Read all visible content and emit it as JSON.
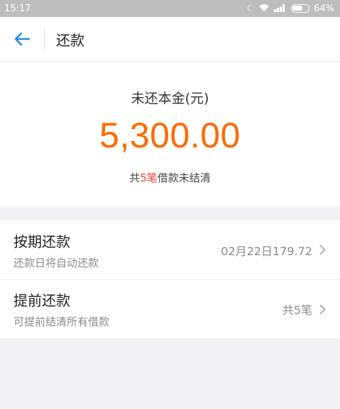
{
  "status_bar": {
    "time": "15:17",
    "moon_icon": "moon-icon",
    "wifi_icon": "wifi-icon",
    "signal_icon": "signal-icon",
    "battery_percent": "64%",
    "battery_level": 0.64
  },
  "header": {
    "title": "还款",
    "back_icon": "arrow-left-icon",
    "accent_color": "#1e88e5"
  },
  "summary": {
    "label": "未还本金(元)",
    "amount": "5,300.00",
    "amount_color": "#ff6a00",
    "note_prefix": "共",
    "note_count": "5笔",
    "note_suffix": "借款未结清",
    "highlight_color": "#ff3b30"
  },
  "repay_options": [
    {
      "title": "按期还款",
      "subtitle": "还款日将自动还款",
      "value": "02月22日179.72",
      "icon": "chevron-right-icon"
    },
    {
      "title": "提前还款",
      "subtitle": "可提前结清所有借款",
      "value": "共5笔",
      "icon": "chevron-right-icon"
    }
  ]
}
